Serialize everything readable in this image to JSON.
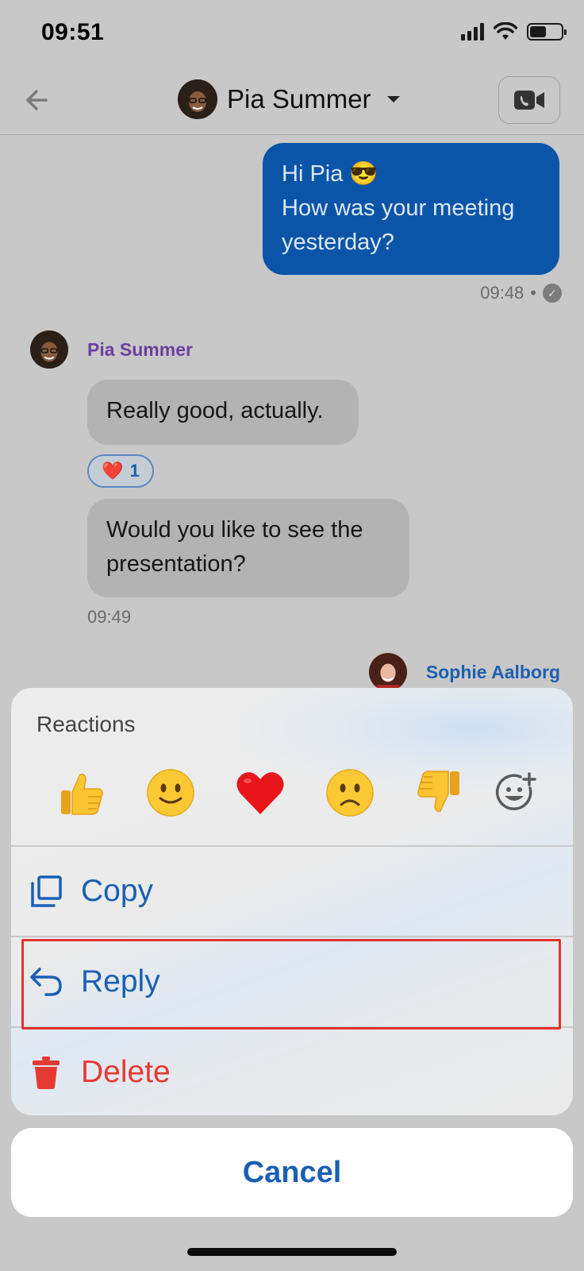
{
  "status_bar": {
    "time": "09:51"
  },
  "header": {
    "title": "Pia Summer"
  },
  "messages": {
    "outgoing": {
      "line1": "Hi Pia",
      "emoji": "😎",
      "line2": "How was your meeting yesterday?",
      "time": "09:48",
      "separator": "•"
    },
    "sender_name": "Pia Summer",
    "incoming_1": "Really good, actually.",
    "reaction": {
      "emoji": "❤️",
      "count": "1"
    },
    "incoming_2": "Would you like to see the presentation?",
    "incoming_time": "09:49",
    "next_sender": "Sophie Aalborg"
  },
  "sheet": {
    "reactions_title": "Reactions",
    "emojis": [
      "👍",
      "🙂",
      "❤️",
      "☹️",
      "👎"
    ],
    "copy_label": "Copy",
    "reply_label": "Reply",
    "delete_label": "Delete"
  },
  "cancel_label": "Cancel",
  "colors": {
    "accent": "#1a5fb4",
    "danger": "#e53a33",
    "outgoing_bubble": "#0b55a8",
    "sender_name": "#6b3fa0",
    "highlight": "#e0332f"
  }
}
